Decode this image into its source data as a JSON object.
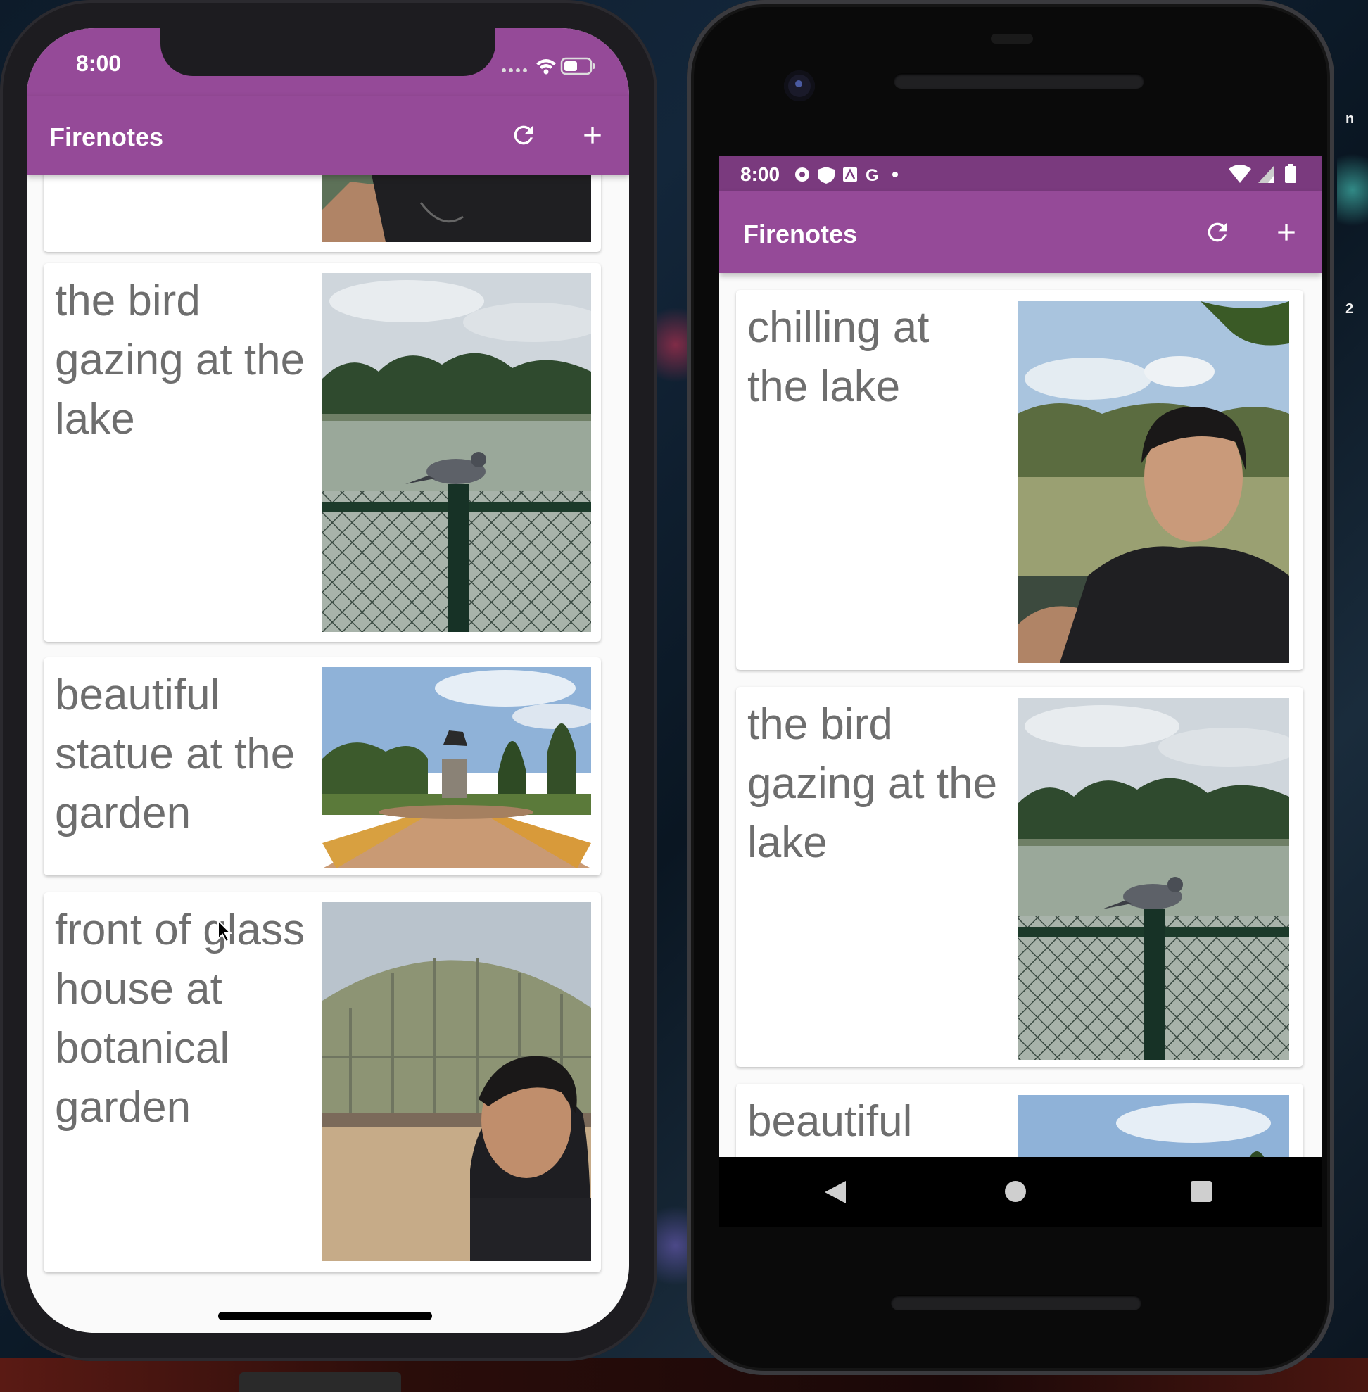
{
  "ios": {
    "status_time": "8:00",
    "app_title": "Firenotes",
    "notes": [
      {
        "text": "",
        "photo": "selfie-crop"
      },
      {
        "text": "the bird gazing at the lake",
        "photo": "pigeon-lake"
      },
      {
        "text": "beautiful statue at the garden",
        "photo": "statue-garden"
      },
      {
        "text": "front of glass house at botanical garden",
        "photo": "glass-house-selfie"
      }
    ]
  },
  "android": {
    "status_time": "8:00",
    "app_title": "Firenotes",
    "notes": [
      {
        "text": "chilling at the lake",
        "photo": "lake-selfie"
      },
      {
        "text": "the bird gazing at the lake",
        "photo": "pigeon-lake"
      },
      {
        "text": "beautiful",
        "photo": "statue-garden"
      }
    ]
  },
  "colors": {
    "appbar": "#954a98",
    "android_status": "#7a3a7e",
    "note_text": "#6e6e6e"
  },
  "icons": [
    "refresh-icon",
    "add-icon",
    "wifi-icon",
    "battery-icon",
    "settings-icon",
    "shield-icon",
    "back-icon",
    "home-icon",
    "recents-icon"
  ]
}
